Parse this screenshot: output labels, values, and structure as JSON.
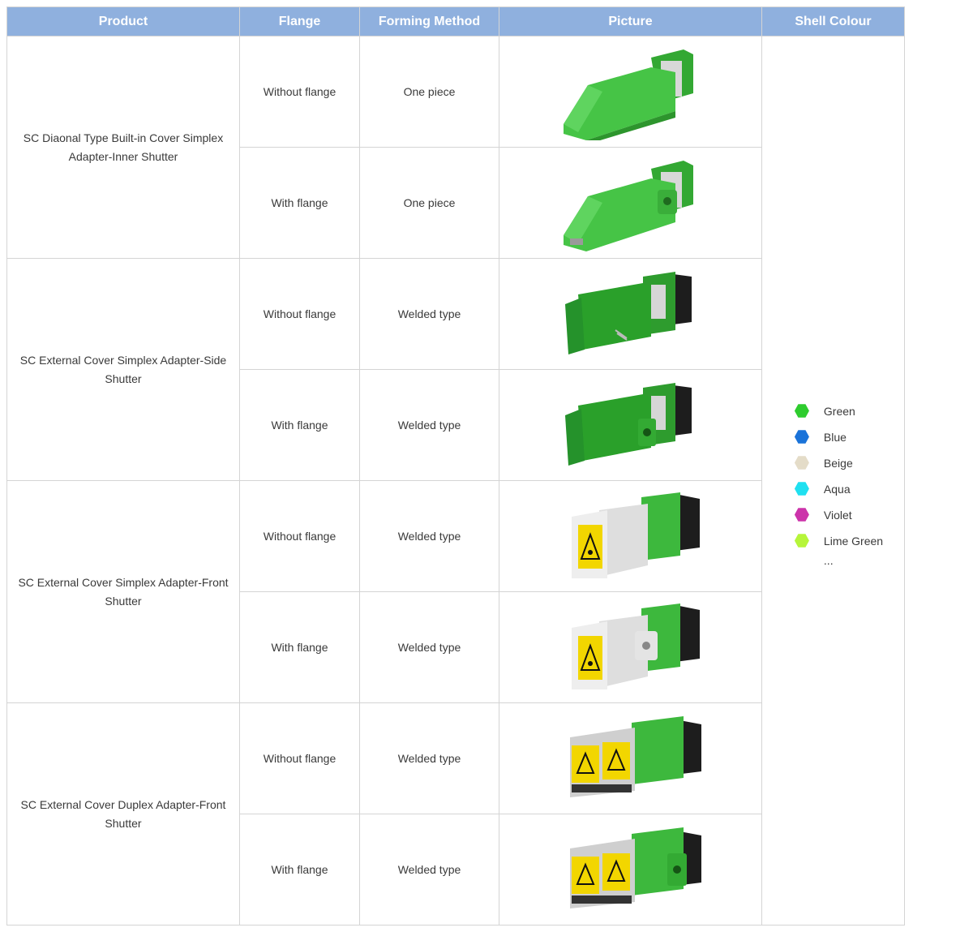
{
  "headers": {
    "product": "Product",
    "flange": "Flange",
    "forming": "Forming Method",
    "picture": "Picture",
    "colour": "Shell Colour"
  },
  "products": [
    {
      "name": "SC Diaonal Type Built-in Cover Simplex Adapter-Inner Shutter",
      "rows": [
        {
          "flange": "Without flange",
          "forming": "One piece",
          "picture_icon": "green-diagonal-cover-adapter-icon"
        },
        {
          "flange": "With flange",
          "forming": "One piece",
          "picture_icon": "green-diagonal-cover-adapter-flange-icon"
        }
      ]
    },
    {
      "name": "SC External Cover Simplex Adapter-Side Shutter",
      "rows": [
        {
          "flange": "Without flange",
          "forming": "Welded type",
          "picture_icon": "green-side-shutter-adapter-icon"
        },
        {
          "flange": "With flange",
          "forming": "Welded type",
          "picture_icon": "green-side-shutter-adapter-flange-icon"
        }
      ]
    },
    {
      "name": "SC External Cover Simplex Adapter-Front Shutter",
      "rows": [
        {
          "flange": "Without flange",
          "forming": "Welded type",
          "picture_icon": "front-shutter-simplex-adapter-icon"
        },
        {
          "flange": "With flange",
          "forming": "Welded type",
          "picture_icon": "front-shutter-simplex-adapter-flange-icon"
        }
      ]
    },
    {
      "name": "SC External Cover Duplex Adapter-Front Shutter",
      "rows": [
        {
          "flange": "Without flange",
          "forming": "Welded type",
          "picture_icon": "front-shutter-duplex-adapter-icon"
        },
        {
          "flange": "With flange",
          "forming": "Welded type",
          "picture_icon": "front-shutter-duplex-adapter-flange-icon"
        }
      ]
    }
  ],
  "colours": [
    {
      "name": "Green",
      "hex": "#2ecc2e"
    },
    {
      "name": "Blue",
      "hex": "#1a73d9"
    },
    {
      "name": "Beige",
      "hex": "#e4dcc8"
    },
    {
      "name": "Aqua",
      "hex": "#1fe0f0"
    },
    {
      "name": "Violet",
      "hex": "#cc33aa"
    },
    {
      "name": "Lime Green",
      "hex": "#b6f53a"
    }
  ],
  "colours_more": "...",
  "style": {
    "header_bg": "#8fb0de",
    "adapter_green": "#3fbf3f",
    "warning_yellow": "#f2d600"
  }
}
